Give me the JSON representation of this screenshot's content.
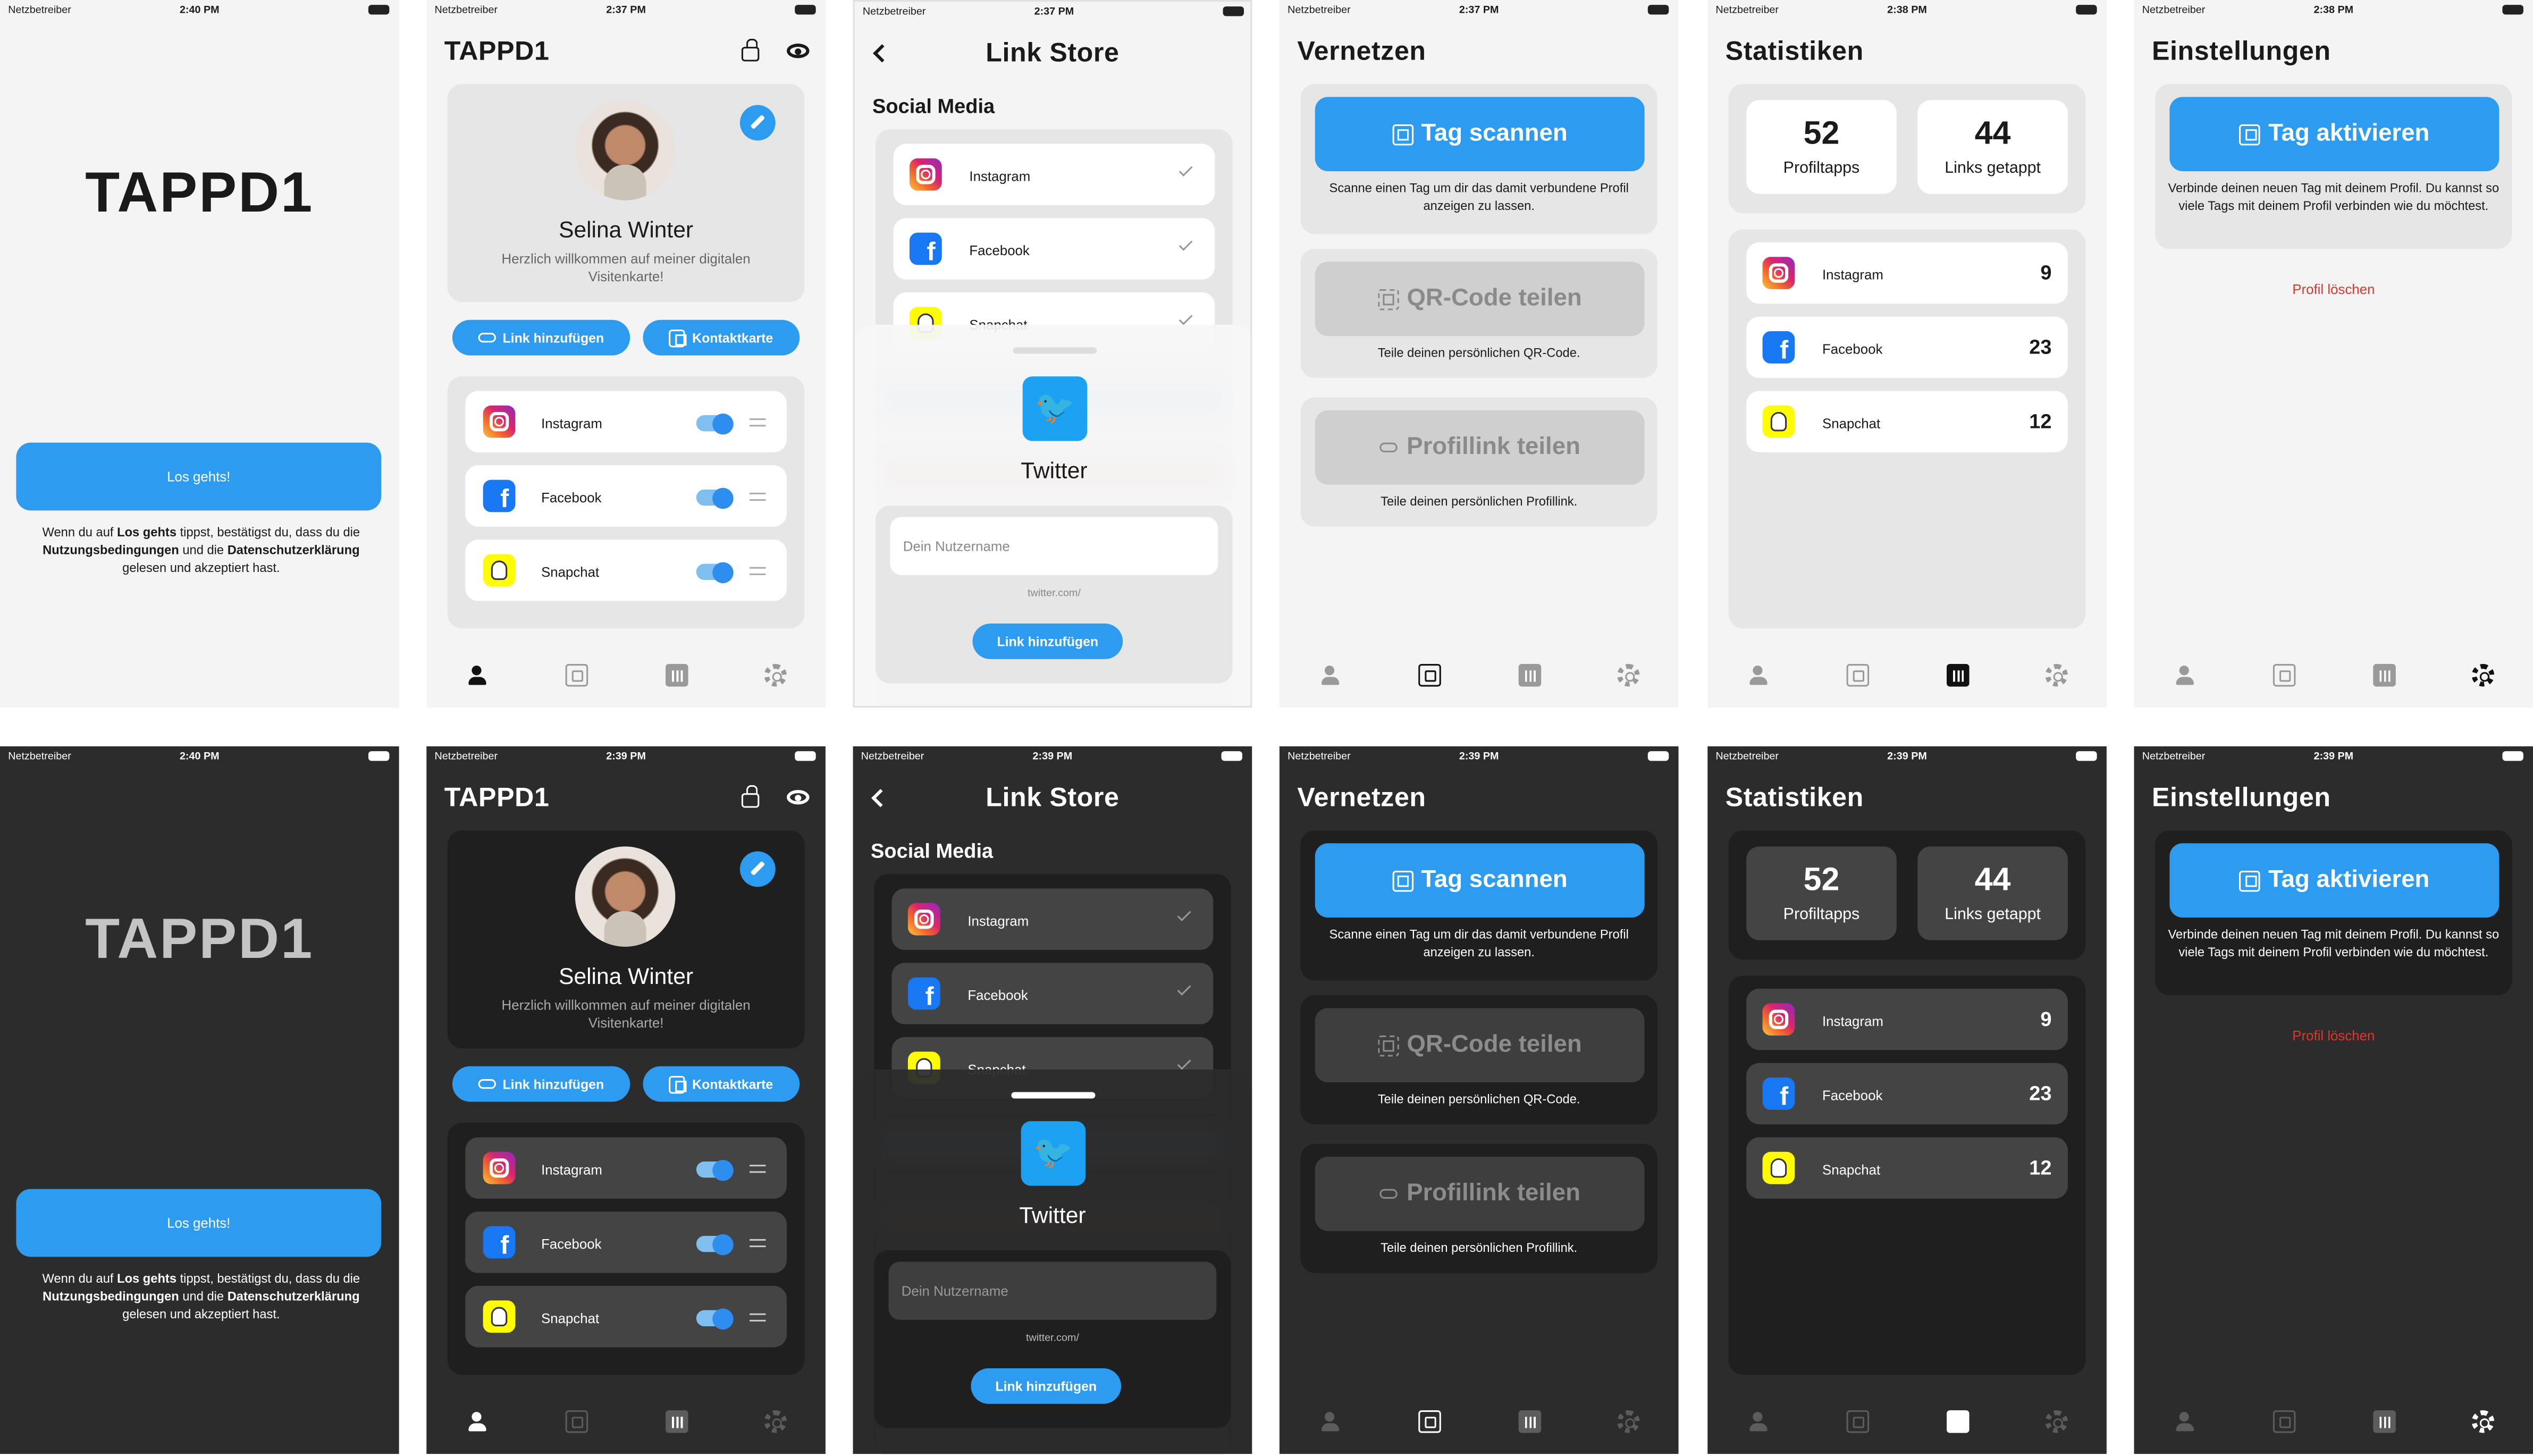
{
  "status": {
    "carrier": "Netzbetreiber",
    "time_welcome": "2:40 PM",
    "time_profile_light": "2:37 PM",
    "time_store_light": "2:37 PM",
    "time_vernetzen_light": "2:37 PM",
    "time_stats_light": "2:38 PM",
    "time_settings_light": "2:38 PM",
    "time_profile_dark": "2:39 PM",
    "time_store_dark": "2:39 PM",
    "time_vernetzen_dark": "2:39 PM",
    "time_stats_dark": "2:39 PM",
    "time_settings_dark": "2:39 PM"
  },
  "welcome": {
    "brand": "TAPPD1",
    "cta": "Los gehts!",
    "legal_1": "Wenn du auf ",
    "legal_b1": "Los gehts",
    "legal_2": " tippst, bestätigst du, dass du die ",
    "legal_b2": "Nutzungsbedingungen",
    "legal_3": " und die ",
    "legal_b3": "Datenschutzerklärung",
    "legal_4": " gelesen und akzeptiert hast."
  },
  "profile": {
    "title": "TAPPD1",
    "name": "Selina Winter",
    "bio": "Herzlich willkommen auf meiner digitalen Visitenkarte!",
    "add_link": "Link hinzufügen",
    "contact_card": "Kontaktkarte",
    "links": [
      "Instagram",
      "Facebook",
      "Snapchat"
    ]
  },
  "store": {
    "title": "Link Store",
    "section": "Social Media",
    "items": [
      "Instagram",
      "Facebook",
      "Snapchat"
    ],
    "sheet_title": "Twitter",
    "input_placeholder": "Dein Nutzername",
    "url_prefix": "twitter.com/",
    "add_button": "Link hinzufügen"
  },
  "vernetzen": {
    "title": "Vernetzen",
    "scan_button": "Tag scannen",
    "scan_desc": "Scanne einen Tag um dir das damit verbundene Profil anzeigen zu lassen.",
    "qr_button": "QR-Code teilen",
    "qr_desc": "Teile deinen persönlichen QR-Code.",
    "link_button": "Profillink teilen",
    "link_desc": "Teile deinen persönlichen Profillink."
  },
  "stats": {
    "title": "Statistiken",
    "profile_taps": "52",
    "profile_taps_label": "Profiltapps",
    "links_tapped": "44",
    "links_tapped_label": "Links getappt",
    "rows": [
      {
        "label": "Instagram",
        "value": "9"
      },
      {
        "label": "Facebook",
        "value": "23"
      },
      {
        "label": "Snapchat",
        "value": "12"
      }
    ]
  },
  "settings": {
    "title": "Einstellungen",
    "activate_button": "Tag aktivieren",
    "activate_desc": "Verbinde deinen neuen Tag mit deinem Profil. Du kannst so viele Tags mit deinem Profil verbinden wie du möchtest.",
    "delete_profile": "Profil löschen"
  },
  "colors": {
    "accent": "#2d9cf0",
    "danger": "#e0362c",
    "light_bg": "#f4f4f4",
    "dark_bg": "#2c2c2c"
  }
}
